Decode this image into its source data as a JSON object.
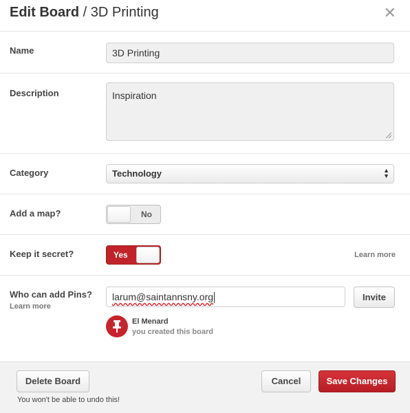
{
  "header": {
    "title_bold": "Edit Board",
    "separator": " / ",
    "board_name": "3D Printing",
    "close_glyph": "✕"
  },
  "form": {
    "name": {
      "label": "Name",
      "value": "3D Printing"
    },
    "description": {
      "label": "Description",
      "value": "Inspiration"
    },
    "category": {
      "label": "Category",
      "selected": "Technology"
    },
    "map": {
      "label": "Add a map?",
      "toggle_text": "No",
      "enabled": false
    },
    "secret": {
      "label": "Keep it secret?",
      "toggle_text": "Yes",
      "enabled": true,
      "learn_more": "Learn more"
    },
    "pins": {
      "label": "Who can add Pins?",
      "learn_more": "Learn more",
      "input_value": "larum@saintannsny.org",
      "invite_label": "Invite",
      "collaborator": {
        "name": "El Menard",
        "subtitle": "you created this board"
      }
    }
  },
  "footer": {
    "delete_label": "Delete Board",
    "delete_note": "You won't be able to undo this!",
    "cancel_label": "Cancel",
    "save_label": "Save Changes"
  },
  "colors": {
    "accent": "#c2232a",
    "background": "#ffffff",
    "footer_bg": "#f2f2f2"
  },
  "icons": {
    "close": "close-icon",
    "pin": "pin-icon",
    "select_arrows": "select-arrows-icon"
  }
}
